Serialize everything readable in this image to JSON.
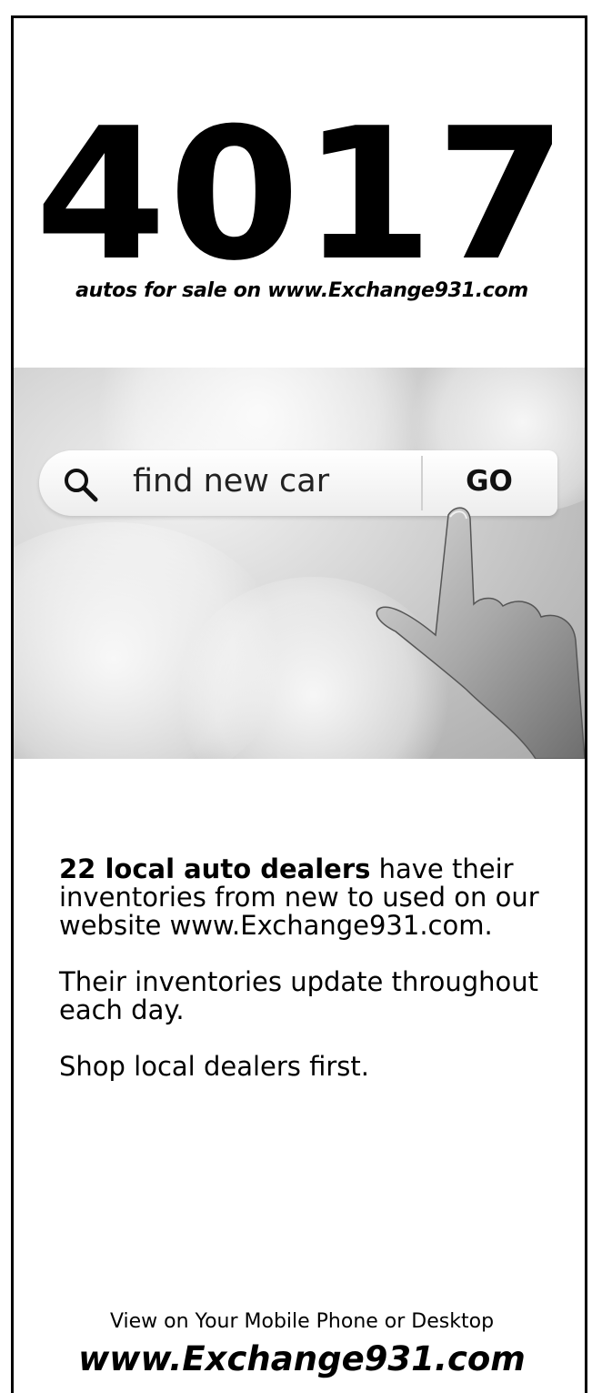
{
  "headline": {
    "count": "4017",
    "subhead": "autos for sale on www.Exchange931.com"
  },
  "photo": {
    "search_query": "find new car",
    "go_label": "GO",
    "search_icon": "search-icon"
  },
  "body": {
    "dealers_bold": "22 local auto dealers",
    "dealers_rest": " have their inventories from new to used on our website www.Exchange931.com.",
    "update_text": "Their inventories update throughout each day.",
    "shop_text": "Shop local dealers first."
  },
  "footer": {
    "tagline": "View on Your Mobile Phone or Desktop",
    "url": "www.Exchange931.com"
  }
}
